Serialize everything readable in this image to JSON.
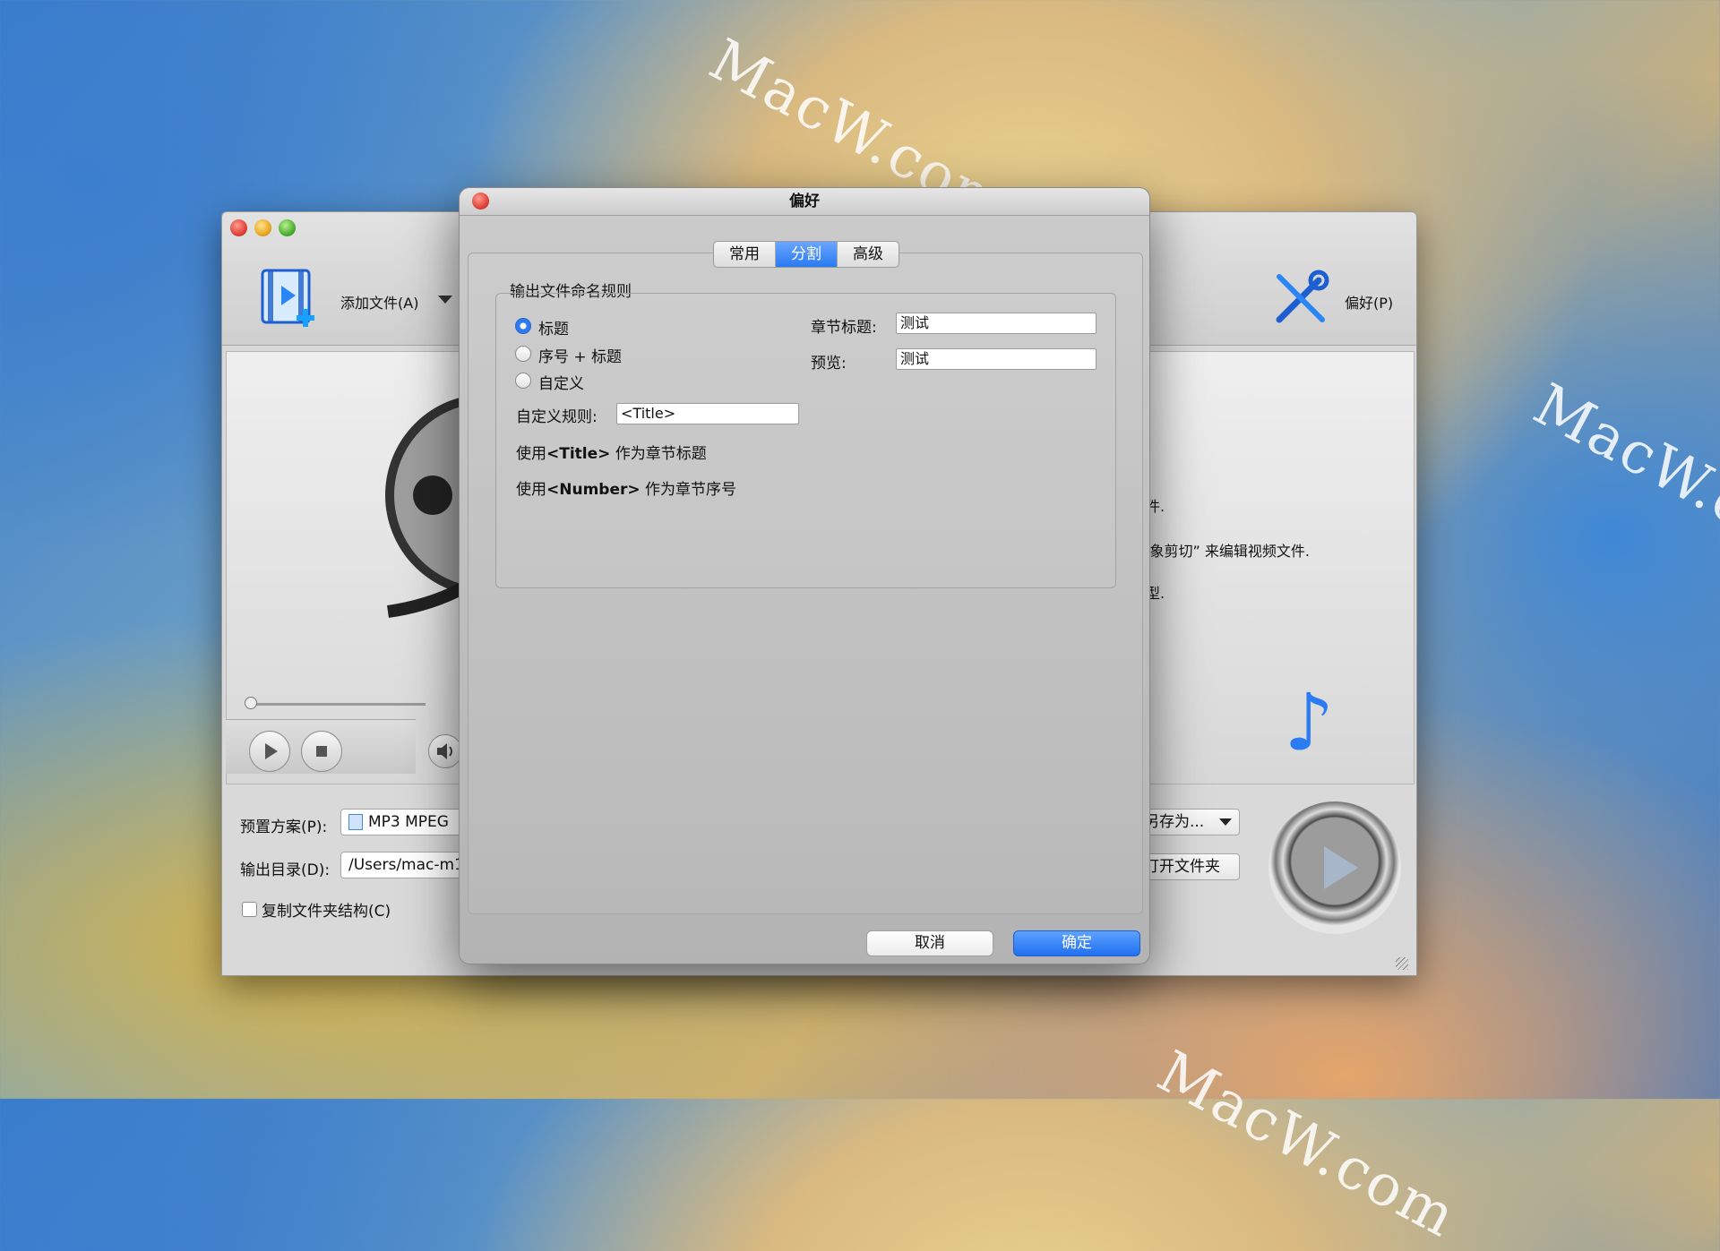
{
  "watermark": "MacW.com",
  "main_window": {
    "toolbar": {
      "add_file_label": "添加文件(A)",
      "preferences_label": "偏好(P)"
    },
    "info_lines": [
      "件.",
      "l象剪切” 来编辑视频文件.",
      "型."
    ],
    "preset_label": "预置方案(P):",
    "preset_value": "MP3 MPEG",
    "save_as_label": "另存为...",
    "output_dir_label": "输出目录(D):",
    "output_dir_value": "/Users/mac-m1",
    "open_folder_label": "打开文件夹",
    "copy_structure_label": "复制文件夹结构(C)"
  },
  "dialog": {
    "title": "偏好",
    "tabs": [
      {
        "label": "常用",
        "active": false
      },
      {
        "label": "分割",
        "active": true
      },
      {
        "label": "高级",
        "active": false
      }
    ],
    "group_title": "输出文件命名规则",
    "naming_options": [
      {
        "label": "标题",
        "selected": true
      },
      {
        "label": "序号 + 标题",
        "selected": false
      },
      {
        "label": "自定义",
        "selected": false
      }
    ],
    "custom_rule_label": "自定义规则:",
    "custom_rule_value": "<Title>",
    "hint_title_prefix": "使用",
    "hint_title_token": "<Title>",
    "hint_title_suffix": " 作为章节标题",
    "hint_number_prefix": "使用",
    "hint_number_token": "<Number>",
    "hint_number_suffix": " 作为章节序号",
    "chapter_title_label": "章节标题:",
    "chapter_title_value": "测试",
    "preview_label": "预览:",
    "preview_value": "测试",
    "cancel_label": "取消",
    "ok_label": "确定"
  },
  "colors": {
    "accent": "#2a7af1"
  }
}
